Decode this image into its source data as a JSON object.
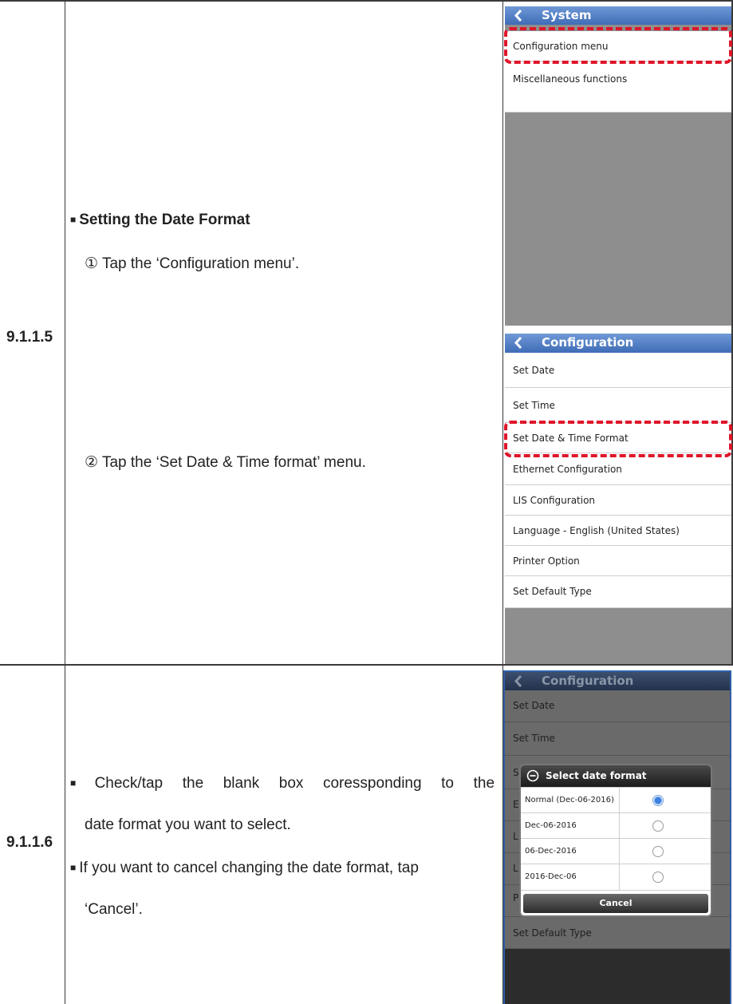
{
  "section_1": {
    "number": "9.1.1.5",
    "heading": "Setting the Date Format",
    "step1": "① Tap the ‘Configuration menu’.",
    "step2": "② Tap the ‘Set Date & Time format’ menu."
  },
  "section_2": {
    "number": "9.1.1.6",
    "bullet1_line1": "Check/tap the blank box coressponding to the",
    "bullet1_line2": "date format you want to select.",
    "bullet2_line1": "If you want to cancel changing the date format, tap",
    "bullet2_line2": "‘Cancel’."
  },
  "screen_system": {
    "title": "System",
    "items": [
      "Configuration menu",
      "Miscellaneous functions"
    ]
  },
  "screen_config": {
    "title": "Configuration",
    "items": [
      "Set Date",
      "Set Time",
      "Set Date & Time Format",
      "Ethernet Configuration",
      "LIS Configuration",
      "Language - English (United States)",
      "Printer Option",
      "Set Default Type"
    ]
  },
  "screen_dialog": {
    "bg_title": "Configuration",
    "bg_items": [
      "Set Date",
      "Set Time",
      "S",
      "E",
      "L",
      "L",
      "P",
      "Set Default Type"
    ],
    "dialog_title": "Select date format",
    "options": [
      {
        "label": "Normal (Dec-06-2016)",
        "selected": true
      },
      {
        "label": "Dec-06-2016",
        "selected": false
      },
      {
        "label": "06-Dec-2016",
        "selected": false
      },
      {
        "label": "2016-Dec-06",
        "selected": false
      }
    ],
    "cancel_label": "Cancel"
  },
  "colors": {
    "header_blue": "#3e6cb6",
    "highlight_red": "#e0152a",
    "radio_selected": "#3b7fe0"
  }
}
